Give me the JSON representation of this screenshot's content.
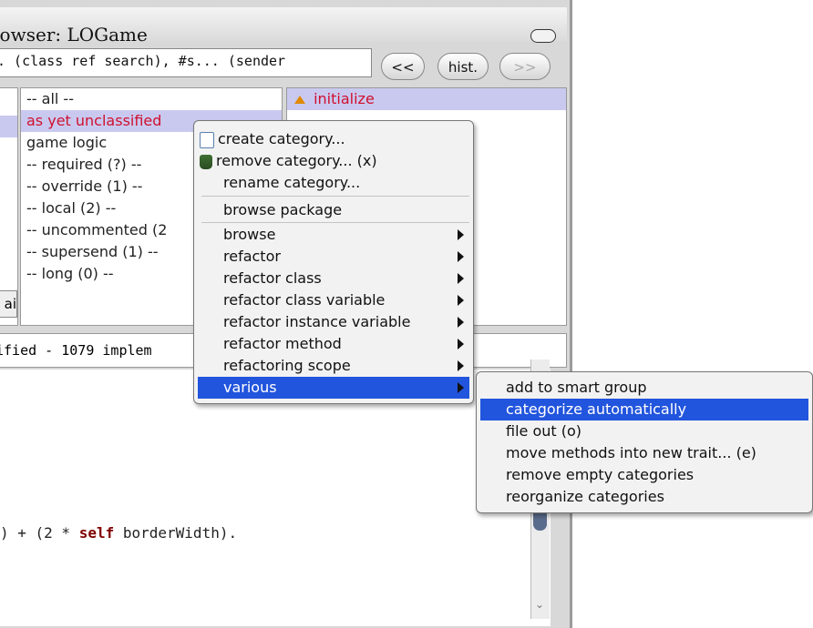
{
  "window": {
    "title": "rowser: LOGame"
  },
  "search": {
    "value": ". (class ref search), #s... (sender"
  },
  "nav": {
    "back": "<<",
    "history": "hist.",
    "forward": ">>"
  },
  "categories": [
    "-- all --",
    "as yet unclassified",
    "game logic",
    "-- required (?) --",
    "-- override (1) --",
    "-- local (2) --",
    "-- uncommented (2",
    "-- supersend (1) --",
    "-- long (0) --"
  ],
  "methods": [
    "initialize"
  ],
  "side_button_text": "ai",
  "status": {
    "text": "ified - 1079 implem"
  },
  "code": {
    "prefix": ") + (2 * ",
    "keyword": "self",
    "suffix": " borderWidth)."
  },
  "context_menu": {
    "group1": [
      "create category...",
      "remove category... (x)",
      "rename category..."
    ],
    "group2": [
      "browse package"
    ],
    "group3": [
      "browse",
      "refactor",
      "refactor class",
      "refactor class variable",
      "refactor instance variable",
      "refactor method",
      "refactoring scope",
      "various"
    ],
    "highlighted": "various"
  },
  "submenu": {
    "items": [
      "add to smart group",
      "categorize automatically",
      "file out (o)",
      "move methods into new trait... (e)",
      "remove empty categories",
      "reorganize categories"
    ],
    "highlighted": "categorize automatically"
  },
  "colors": {
    "highlight": "#2255dd",
    "selection": "#c9c9f0",
    "red_text": "#d0102e",
    "keyword": "#800000"
  }
}
